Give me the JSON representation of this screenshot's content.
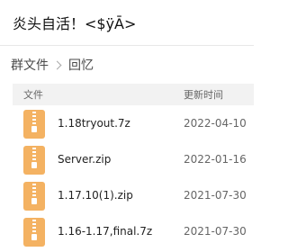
{
  "window": {
    "title": "炎头自活！<$ÿĀ>"
  },
  "breadcrumb": {
    "root": "群文件",
    "current": "回忆"
  },
  "list_header": {
    "name": "文件",
    "time": "更新时间"
  },
  "files": [
    {
      "name": "1.18tryout.7z",
      "date": "2022-04-10",
      "icon": "zip-archive-icon"
    },
    {
      "name": "Server.zip",
      "date": "2022-01-16",
      "icon": "zip-archive-icon"
    },
    {
      "name": "1.17.10(1).zip",
      "date": "2021-07-30",
      "icon": "zip-archive-icon"
    },
    {
      "name": "1.16-1.17,final.7z",
      "date": "2021-07-30",
      "icon": "zip-archive-icon"
    }
  ],
  "colors": {
    "archive_icon": "#f4b262",
    "header_bg": "#f2f2f2"
  }
}
